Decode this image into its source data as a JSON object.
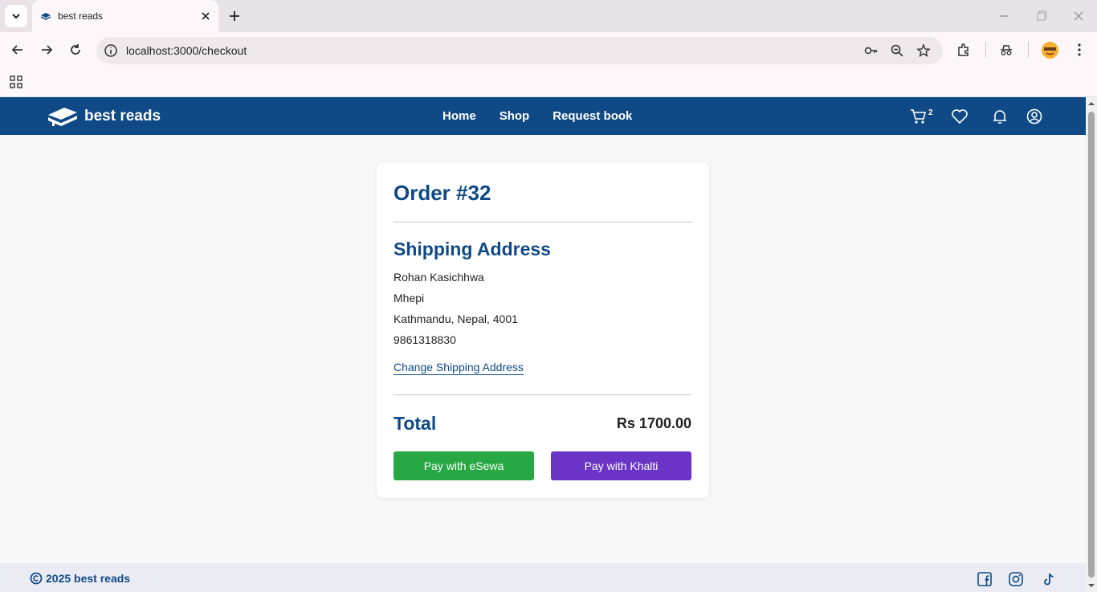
{
  "browser": {
    "tab_title": "best reads",
    "url": "localhost:3000/checkout"
  },
  "site": {
    "brand": "best reads",
    "nav": [
      "Home",
      "Shop",
      "Request book"
    ],
    "cart_count": "2",
    "accent_color": "#0f4a87"
  },
  "order": {
    "title": "Order #32",
    "shipping_title": "Shipping Address",
    "address_lines": [
      "Rohan Kasichhwa",
      "Mhepi",
      "Kathmandu, Nepal, 4001",
      "9861318830"
    ],
    "change_link": "Change Shipping Address",
    "total_label": "Total",
    "total_value": "Rs 1700.00",
    "pay_esewa": "Pay with eSewa",
    "pay_khalti": "Pay with Khalti",
    "esewa_color": "#28a745",
    "khalti_color": "#6a35c7"
  },
  "footer": {
    "year": "2025",
    "brand": "best reads"
  }
}
